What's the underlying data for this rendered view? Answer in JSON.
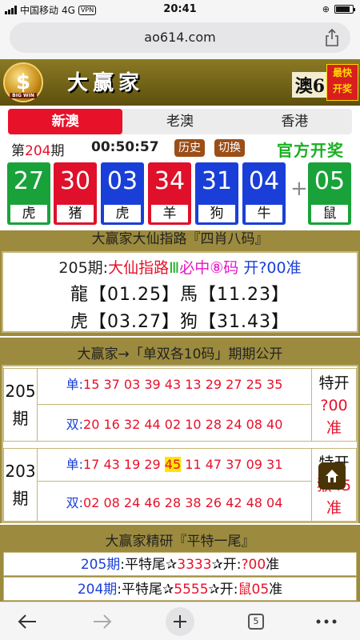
{
  "status_bar": {
    "carrier": "中国移动",
    "network": "4G",
    "vpn": "VPN",
    "time": "20:41"
  },
  "browser": {
    "url": "ao614.com",
    "tab_count": "5"
  },
  "header": {
    "logo_text": "$",
    "logo_caption": "BIG WIN",
    "site_title": "大赢家",
    "right_text": "澳6",
    "badge_line1": "最快",
    "badge_line2": "开奖"
  },
  "tabs": [
    {
      "label": "新澳",
      "active": true
    },
    {
      "label": "老澳",
      "active": false
    },
    {
      "label": "香港",
      "active": false
    }
  ],
  "draw": {
    "period_prefix": "第",
    "period_number": "204",
    "period_suffix": "期",
    "countdown": "00:50:57",
    "history_label": "历史",
    "switch_label": "切换",
    "official_label": "官方开奖"
  },
  "balls": [
    {
      "number": "27",
      "zodiac": "虎",
      "color": "green"
    },
    {
      "number": "30",
      "zodiac": "猪",
      "color": "red"
    },
    {
      "number": "03",
      "zodiac": "虎",
      "color": "blue"
    },
    {
      "number": "34",
      "zodiac": "羊",
      "color": "red"
    },
    {
      "number": "31",
      "zodiac": "狗",
      "color": "blue"
    },
    {
      "number": "04",
      "zodiac": "牛",
      "color": "blue"
    },
    {
      "number": "05",
      "zodiac": "鼠",
      "color": "green"
    }
  ],
  "section1": {
    "title": "大赢家大仙指路『四肖八码』",
    "line_period": "205期:",
    "line_red": "大仙指路",
    "line_green": "Ⅲ",
    "line_mag": "必中⑧码",
    "line_blue": "开?00准",
    "row1": "龍【01.25】馬【11.23】",
    "row2": "虎【03.27】狗【31.43】"
  },
  "section2": {
    "title": "大赢家→「单双各10码」期期公开",
    "odd_label": "单:",
    "even_label": "双:",
    "groups": [
      {
        "period_line1": "205",
        "period_line2": "期",
        "odd": "15 37 03 39 43 13 29 27 25 35",
        "even": "20 16 32 44 02 10 28 24 08 40",
        "right_line1": "特开",
        "right_line2": "?00",
        "right_line3": "准"
      },
      {
        "period_line1": "203",
        "period_line2": "期",
        "odd_before": "17 43 19 29",
        "odd_highlight": "45",
        "odd_after": "11 47 37 09 31",
        "even": "02 08 24 46 28 38 26 42 48 04",
        "right_line1": "特开",
        "right_line2": "猴45",
        "right_line3": "准"
      }
    ]
  },
  "section3": {
    "title": "大赢家精研『平特一尾』",
    "rows": [
      {
        "period": "205期",
        "label": ":平特尾",
        "star": "✰",
        "value": "3333",
        "star2": "✰",
        "open": "开:",
        "result": "?00",
        "suffix": "准"
      },
      {
        "period": "204期",
        "label": ":平特尾",
        "star": "✰",
        "value": "5555",
        "star2": "✰",
        "open": "开:",
        "result": "鼠05",
        "suffix": "准"
      }
    ]
  },
  "colors": {
    "red": "#e0102a",
    "blue": "#1a3fd8",
    "green": "#19a23a",
    "band": "#9c8b3e"
  }
}
